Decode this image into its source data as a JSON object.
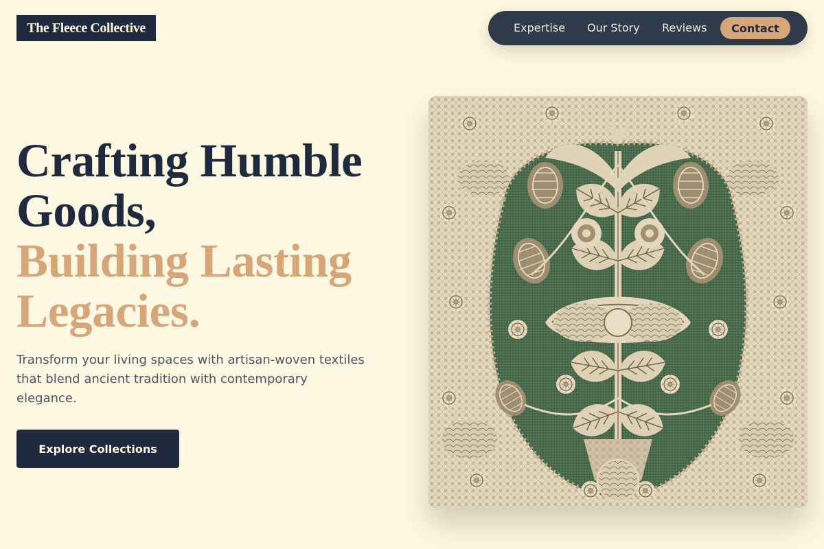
{
  "brand": {
    "name": "The Fleece Collective"
  },
  "nav": {
    "items": [
      {
        "label": "Expertise"
      },
      {
        "label": "Our Story"
      },
      {
        "label": "Reviews"
      }
    ],
    "contact_label": "Contact"
  },
  "hero": {
    "title_dark": [
      "Crafting Humble",
      "Goods,"
    ],
    "title_accent": [
      "Building Lasting",
      "Legacies."
    ],
    "subtitle": "Transform your living spaces with artisan-woven textiles that blend ancient tradition with contemporary elegance.",
    "cta_label": "Explore Collections"
  },
  "artwork": {
    "subject": "green-and-cream damask textile pattern"
  },
  "colors": {
    "background": "#fdf8e1",
    "navy": "#1f2a3e",
    "accent": "#d6a578",
    "nav_pill": "#2f3a4b",
    "body_text": "#4d5563",
    "textile_green": "#4a6b4c",
    "textile_cream": "#e5d8c0"
  }
}
